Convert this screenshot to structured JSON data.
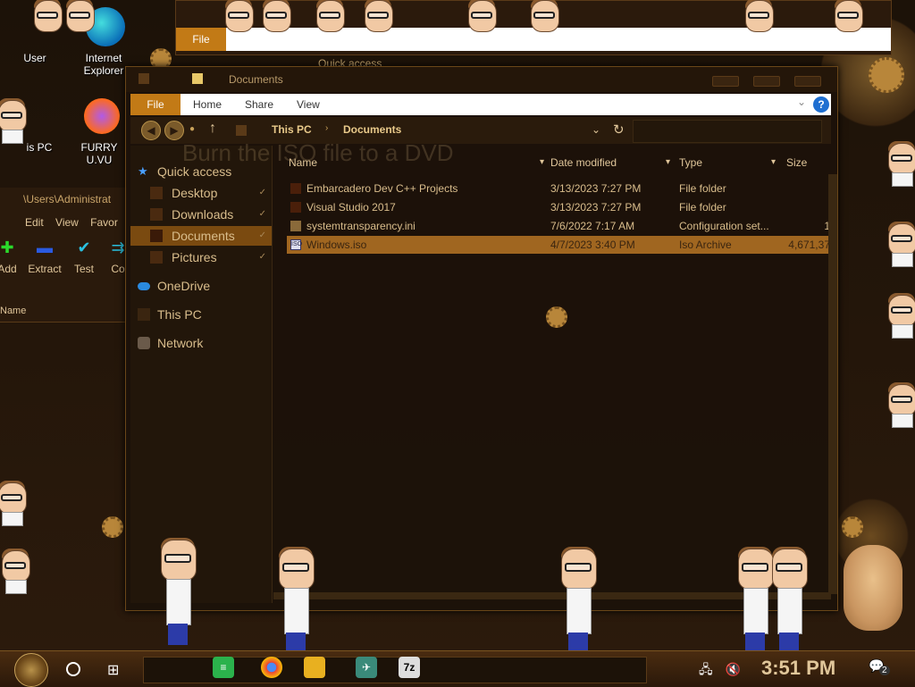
{
  "desktop": {
    "icons": [
      {
        "label": "User"
      },
      {
        "label": "Internet Explorer"
      },
      {
        "label": "is PC"
      },
      {
        "label": "FURRY U.VU"
      }
    ]
  },
  "background_window": {
    "file_tab": "File",
    "quick_access": "Quick access"
  },
  "overlay_text": "Burn the ISO file to a DVD",
  "zip": {
    "title": "\\Users\\Administrat",
    "menu": [
      "Edit",
      "View",
      "Favor"
    ],
    "tools": [
      "Add",
      "Extract",
      "Test",
      "Co"
    ],
    "col_name": "Name"
  },
  "window": {
    "title": "Documents",
    "ribbon_tabs": [
      "File",
      "Home",
      "Share",
      "View"
    ],
    "help": "?",
    "breadcrumb": [
      "This PC",
      "Documents"
    ],
    "nav": {
      "quick_access": "Quick access",
      "desktop": "Desktop",
      "downloads": "Downloads",
      "documents": "Documents",
      "pictures": "Pictures",
      "onedrive": "OneDrive",
      "this_pc": "This PC",
      "network": "Network"
    },
    "columns": [
      "Name",
      "Date modified",
      "Type",
      "Size"
    ],
    "files": [
      {
        "name": "Embarcadero Dev C++ Projects",
        "date": "3/13/2023 7:27 PM",
        "type": "File folder",
        "size": ""
      },
      {
        "name": "Visual Studio 2017",
        "date": "3/13/2023 7:27 PM",
        "type": "File folder",
        "size": ""
      },
      {
        "name": "systemtransparency.ini",
        "date": "7/6/2022 7:17 AM",
        "type": "Configuration set...",
        "size": "1"
      },
      {
        "name": "Windows.iso",
        "date": "4/7/2023 3:40 PM",
        "type": "Iso Archive",
        "size": "4,671,37"
      }
    ]
  },
  "taskbar": {
    "clock": "3:51 PM",
    "notifications": "2"
  },
  "colors": {
    "accent": "#c27a16",
    "selection": "#a06620",
    "text": "#e0c69a"
  }
}
